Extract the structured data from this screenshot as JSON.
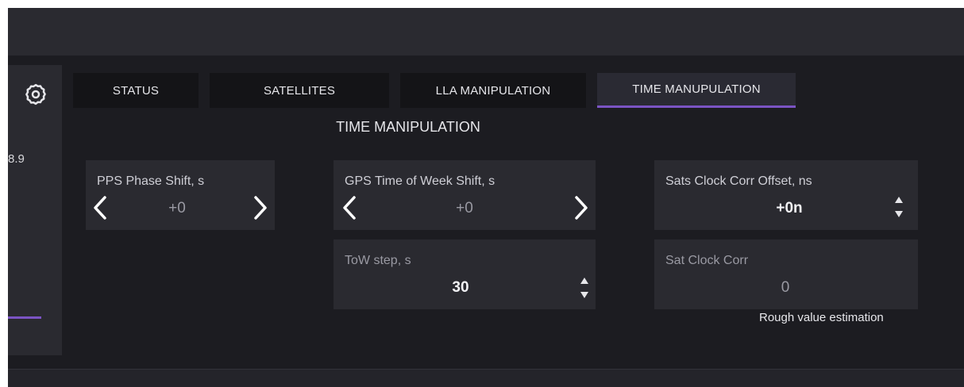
{
  "left_panel": {
    "value": "8.9"
  },
  "tabs": [
    {
      "label": "STATUS",
      "active": false
    },
    {
      "label": "SATELLITES",
      "active": false
    },
    {
      "label": "LLA MANIPULATION",
      "active": false
    },
    {
      "label": "TIME MANUPULATION",
      "active": true
    }
  ],
  "section_title": "TIME MANIPULATION",
  "pps": {
    "label": "PPS Phase Shift, s",
    "value": "+0"
  },
  "gps_tow": {
    "label": "GPS Time of Week Shift, s",
    "value": "+0"
  },
  "tow_step": {
    "label": "ToW step, s",
    "value": "30"
  },
  "sats_clock_offset": {
    "label": "Sats Clock Corr Offset, ns",
    "value": "+0n"
  },
  "sat_clock_corr": {
    "label": "Sat Clock Corr",
    "value": "0"
  },
  "note": "Rough value estimation",
  "colors": {
    "accent": "#7b54c4",
    "background": "#1c1c21",
    "card": "#2a2a30"
  }
}
